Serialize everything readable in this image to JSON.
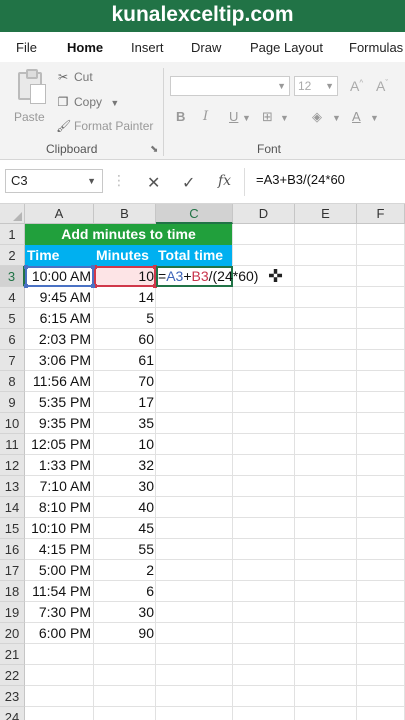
{
  "banner": {
    "text": "kunalexceltip.com"
  },
  "tabs": [
    {
      "label": "File",
      "active": false
    },
    {
      "label": "Home",
      "active": true
    },
    {
      "label": "Insert",
      "active": false
    },
    {
      "label": "Draw",
      "active": false
    },
    {
      "label": "Page Layout",
      "active": false
    },
    {
      "label": "Formulas",
      "active": false
    }
  ],
  "ribbon": {
    "paste_label": "Paste",
    "cut_label": "Cut",
    "copy_label": "Copy",
    "format_painter_label": "Format Painter",
    "clipboard_group": "Clipboard",
    "font_group": "Font",
    "font_size": "12",
    "bold": "B",
    "italic": "I",
    "underline": "U"
  },
  "formula_bar": {
    "name_box": "C3",
    "cancel_icon": "✕",
    "enter_icon": "✓",
    "fx": "fx",
    "formula": "=A3+B3/(24*60"
  },
  "sheet": {
    "columns": [
      "A",
      "B",
      "C",
      "D",
      "E",
      "F"
    ],
    "rows": [
      "1",
      "2",
      "3",
      "4",
      "5",
      "6",
      "7",
      "8",
      "9",
      "10",
      "11",
      "12",
      "13",
      "14",
      "15",
      "16",
      "17",
      "18",
      "19",
      "20",
      "21",
      "22",
      "23",
      "24"
    ],
    "title": "Add minutes to time",
    "headers": {
      "time": "Time",
      "minutes": "Minutes",
      "total": "Total time"
    },
    "data": [
      {
        "time": "10:00 AM",
        "minutes": "10"
      },
      {
        "time": "9:45 AM",
        "minutes": "14"
      },
      {
        "time": "6:15 AM",
        "minutes": "5"
      },
      {
        "time": "2:03 PM",
        "minutes": "60"
      },
      {
        "time": "3:06 PM",
        "minutes": "61"
      },
      {
        "time": "11:56 AM",
        "minutes": "70"
      },
      {
        "time": "5:35 PM",
        "minutes": "17"
      },
      {
        "time": "9:35 PM",
        "minutes": "35"
      },
      {
        "time": "12:05 PM",
        "minutes": "10"
      },
      {
        "time": "1:33 PM",
        "minutes": "32"
      },
      {
        "time": "7:10 AM",
        "minutes": "30"
      },
      {
        "time": "8:10 PM",
        "minutes": "40"
      },
      {
        "time": "10:10 PM",
        "minutes": "45"
      },
      {
        "time": "4:15 PM",
        "minutes": "55"
      },
      {
        "time": "5:00 PM",
        "minutes": "2"
      },
      {
        "time": "11:54 PM",
        "minutes": "6"
      },
      {
        "time": "7:30 PM",
        "minutes": "30"
      },
      {
        "time": "6:00 PM",
        "minutes": "90"
      }
    ],
    "editing": {
      "prefix": "=",
      "ref_a": "A3",
      "plus": "+",
      "ref_b": "B3",
      "rest": "/(24*60)"
    }
  },
  "colors": {
    "excel_green": "#217346",
    "title_fill": "#21a03c",
    "header_fill": "#00b0f0",
    "ref_blue": "#4a72c4",
    "ref_red": "#d0384a"
  }
}
